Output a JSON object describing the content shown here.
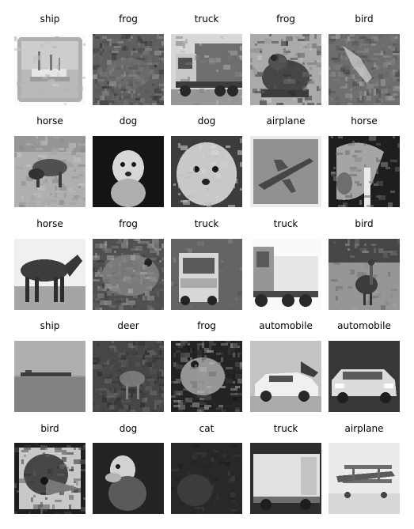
{
  "figure": {
    "cells": [
      {
        "label": "ship",
        "image": "ship-photo"
      },
      {
        "label": "frog",
        "image": "frog-photo"
      },
      {
        "label": "truck",
        "image": "truck-photo"
      },
      {
        "label": "frog",
        "image": "frog-photo"
      },
      {
        "label": "bird",
        "image": "bird-photo"
      },
      {
        "label": "horse",
        "image": "horse-photo"
      },
      {
        "label": "dog",
        "image": "dog-photo"
      },
      {
        "label": "dog",
        "image": "dog-photo"
      },
      {
        "label": "airplane",
        "image": "airplane-photo"
      },
      {
        "label": "horse",
        "image": "horse-photo"
      },
      {
        "label": "horse",
        "image": "horse-photo"
      },
      {
        "label": "frog",
        "image": "frog-photo"
      },
      {
        "label": "truck",
        "image": "truck-photo"
      },
      {
        "label": "truck",
        "image": "truck-photo"
      },
      {
        "label": "bird",
        "image": "bird-photo"
      },
      {
        "label": "ship",
        "image": "ship-photo"
      },
      {
        "label": "deer",
        "image": "deer-photo"
      },
      {
        "label": "frog",
        "image": "frog-photo"
      },
      {
        "label": "automobile",
        "image": "automobile-photo"
      },
      {
        "label": "automobile",
        "image": "automobile-photo"
      },
      {
        "label": "bird",
        "image": "bird-photo"
      },
      {
        "label": "dog",
        "image": "dog-photo"
      },
      {
        "label": "cat",
        "image": "cat-photo"
      },
      {
        "label": "truck",
        "image": "truck-photo"
      },
      {
        "label": "airplane",
        "image": "airplane-photo"
      }
    ]
  }
}
